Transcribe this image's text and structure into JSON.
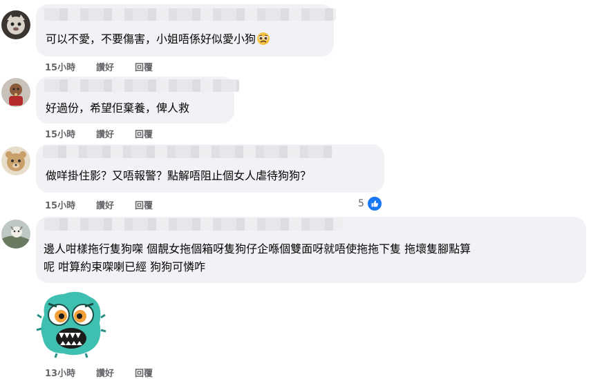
{
  "comments": [
    {
      "text": "可以不愛，不要傷害，小姐唔係好似愛小狗",
      "emoji": "crying-face-emoji",
      "time": "15小時",
      "like_label": "讚好",
      "reply_label": "回覆"
    },
    {
      "text": "好過份，希望佢棄養，俾人救",
      "time": "15小時",
      "like_label": "讚好",
      "reply_label": "回覆"
    },
    {
      "text": "做咩掛住影？又唔報警？點解唔阻止個女人虐待狗狗？",
      "time": "15小時",
      "like_label": "讚好",
      "reply_label": "回覆",
      "reaction_count": "5",
      "reaction_icon": "thumbs-up-icon"
    },
    {
      "text_line1": "邊人咁樣拖行隻狗㗎 個靚女拖個箱呀隻狗仔企喺個雙面呀就唔使拖拖下隻 拖壞隻腳點算",
      "text_line2": "呢 咁算約束㗎喇已經 狗狗可憐咋",
      "sticker": "scared-green-monster-sticker",
      "time": "13小時",
      "like_label": "讚好",
      "reply_label": "回覆"
    }
  ],
  "colors": {
    "bubble": "#f0f2f5",
    "meta": "#65676b",
    "like_blue": "#1877f2"
  }
}
